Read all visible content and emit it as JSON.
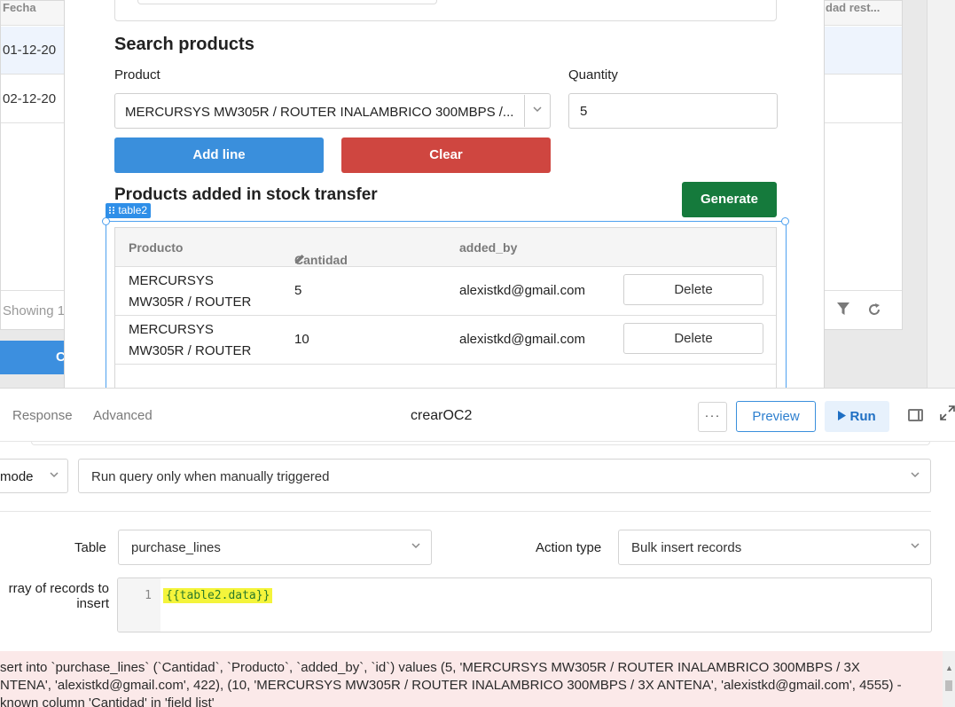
{
  "background": {
    "col_fecha": "Fecha",
    "col_rest": "dad rest...",
    "row1_date": "01-12-20",
    "row2_date": "02-12-20",
    "showing": "Showing 1",
    "blue_button_partial": "C"
  },
  "modal": {
    "search_heading": "Search products",
    "product_label": "Product",
    "product_value": "MERCURSYS MW305R / ROUTER INALAMBRICO 300MBPS /...",
    "quantity_label": "Quantity",
    "quantity_value": "5",
    "add_line": "Add line",
    "clear": "Clear",
    "products_heading": "Products added in stock transfer",
    "generate": "Generate",
    "selection_tag": "table2",
    "table": {
      "headers": [
        "Producto",
        "Cantidad",
        "added_by"
      ],
      "rows": [
        {
          "producto_line1": "MERCURSYS",
          "producto_line2": "MW305R / ROUTER",
          "cantidad": "5",
          "added_by": "alexistkd@gmail.com",
          "action": "Delete"
        },
        {
          "producto_line1": "MERCURSYS",
          "producto_line2": "MW305R / ROUTER",
          "cantidad": "10",
          "added_by": "alexistkd@gmail.com",
          "action": "Delete"
        }
      ]
    }
  },
  "query_editor": {
    "tabs": [
      "Response",
      "Advanced"
    ],
    "title": "crearOC2",
    "preview": "Preview",
    "run": "Run",
    "mode_label": "mode",
    "trigger_value": "Run query only when manually triggered",
    "table_label": "Table",
    "table_value": "purchase_lines",
    "action_label": "Action type",
    "action_value": "Bulk insert records",
    "records_label_line1": "rray of records to",
    "records_label_line2": "insert",
    "code_line_number": "1",
    "code_value": "{{table2.data}}",
    "error_lines": [
      "sert into `purchase_lines` (`Cantidad`, `Producto`, `added_by`, `id`) values (5, 'MERCURSYS MW305R / ROUTER INALAMBRICO 300MBPS / 3X",
      "NTENA', 'alexistkd@gmail.com', 422), (10, 'MERCURSYS MW305R / ROUTER INALAMBRICO 300MBPS / 3X ANTENA', 'alexistkd@gmail.com', 4555) -",
      "known column 'Cantidad' in 'field list'"
    ]
  },
  "colors": {
    "primary_blue": "#3a8fdc",
    "clear_red": "#cf4640",
    "generate_green": "#157a3c",
    "selection_blue": "#2f8fe8",
    "error_bg": "#fbe9e9",
    "code_highlight": "#f4f43b"
  }
}
